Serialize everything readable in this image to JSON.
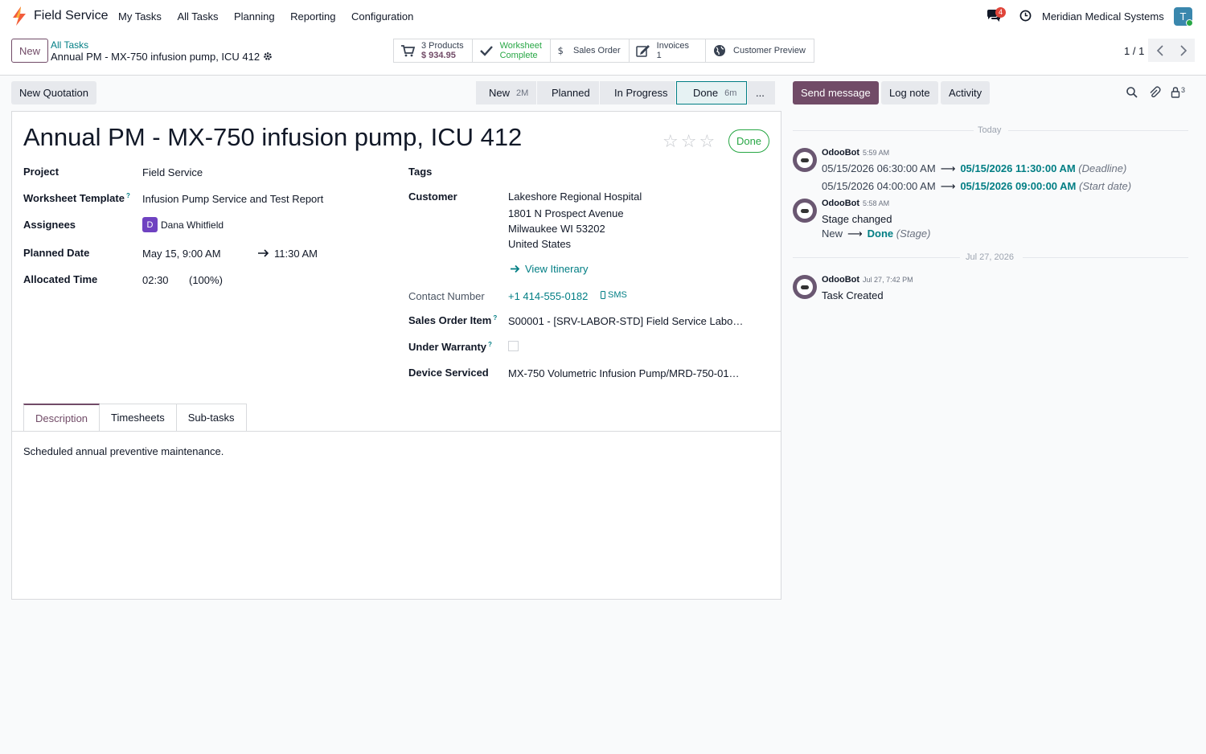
{
  "navbar": {
    "app_name": "Field Service",
    "menu": [
      "My Tasks",
      "All Tasks",
      "Planning",
      "Reporting",
      "Configuration"
    ],
    "chat_count": "4",
    "company": "Meridian Medical Systems",
    "user_initial": "T"
  },
  "control": {
    "new_label": "New",
    "breadcrumb_parent": "All Tasks",
    "breadcrumb_current": "Annual PM - MX-750 infusion pump, ICU 412",
    "smart_buttons": {
      "products_count": "3 Products",
      "products_amount": "$ 934.95",
      "worksheet_line1": "Worksheet",
      "worksheet_line2": "Complete",
      "sales_order": "Sales Order",
      "invoices_label": "Invoices",
      "invoices_count": "1",
      "customer_preview": "Customer Preview"
    },
    "pager": "1 / 1"
  },
  "status": {
    "new_quotation": "New Quotation",
    "stages": [
      {
        "name": "New",
        "duration": "2M"
      },
      {
        "name": "Planned",
        "duration": ""
      },
      {
        "name": "In Progress",
        "duration": ""
      },
      {
        "name": "Done",
        "duration": "6m"
      },
      {
        "name": "...",
        "duration": ""
      }
    ]
  },
  "form": {
    "title": "Annual PM - MX-750 infusion pump, ICU 412",
    "done_label": "Done",
    "project_label": "Project",
    "project": "Field Service",
    "worksheet_label": "Worksheet Template",
    "worksheet": "Infusion Pump Service and Test Report",
    "assignees_label": "Assignees",
    "assignee_initial": "D",
    "assignee": "Dana Whitfield",
    "planned_label": "Planned Date",
    "planned_start": "May 15, 9:00 AM",
    "planned_end": "11:30 AM",
    "allocated_label": "Allocated Time",
    "allocated": "02:30",
    "allocated_pct": "(100%)",
    "tags_label": "Tags",
    "customer_label": "Customer",
    "customer_name": "Lakeshore Regional Hospital",
    "address1": "1801 N Prospect Avenue",
    "address2": "Milwaukee WI 53202",
    "country": "United States",
    "view_itinerary": "View Itinerary",
    "contact_label": "Contact Number",
    "phone": "+1 414-555-0182",
    "sms": "SMS",
    "so_item_label": "Sales Order Item",
    "so_item": "S00001 - [SRV-LABOR-STD] Field Service Labo…",
    "warranty_label": "Under Warranty",
    "device_label": "Device Serviced",
    "device": "MX-750 Volumetric Infusion Pump/MRD-750-01…",
    "tabs": [
      "Description",
      "Timesheets",
      "Sub-tasks"
    ],
    "description": "Scheduled annual preventive maintenance."
  },
  "chatter": {
    "send_message": "Send message",
    "log_note": "Log note",
    "activity": "Activity",
    "followers": "3",
    "today": "Today",
    "msg1_author": "OdooBot",
    "msg1_time": "5:59 AM",
    "msg1_old1": "05/15/2026 06:30:00 AM",
    "msg1_new1": "05/15/2026 11:30:00 AM",
    "msg1_field1": "(Deadline)",
    "msg1_old2": "05/15/2026 04:00:00 AM",
    "msg1_new2": "05/15/2026 09:00:00 AM",
    "msg1_field2": "(Start date)",
    "msg2_author": "OdooBot",
    "msg2_time": "5:58 AM",
    "msg2_text": "Stage changed",
    "msg2_old": "New",
    "msg2_new": "Done",
    "msg2_field": "(Stage)",
    "date2": "Jul 27, 2026",
    "msg3_author": "OdooBot",
    "msg3_time": "Jul 27, 7:42 PM",
    "msg3_text": "Task Created"
  }
}
